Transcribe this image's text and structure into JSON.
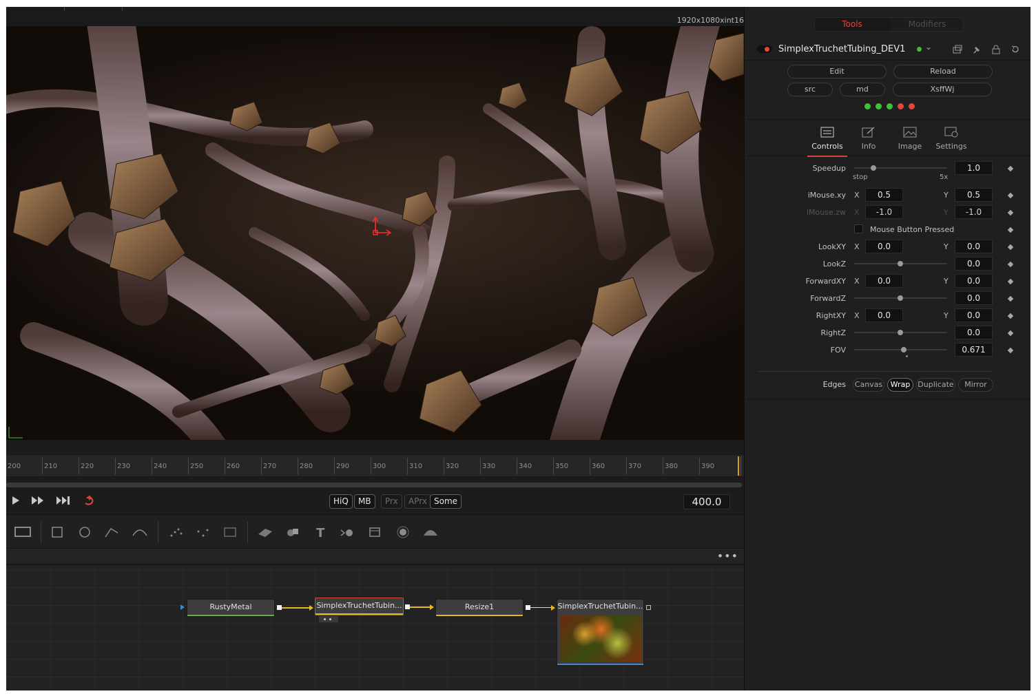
{
  "viewer": {
    "resolution": "1920x1080xint16"
  },
  "timeline": {
    "ruler_labels": [
      "200",
      "210",
      "220",
      "230",
      "240",
      "250",
      "260",
      "270",
      "280",
      "290",
      "300",
      "310",
      "320",
      "330",
      "340",
      "350",
      "360",
      "370",
      "380",
      "390"
    ],
    "current_time": "400.0"
  },
  "transport": {
    "toggles": [
      {
        "label": "HiQ",
        "active": true
      },
      {
        "label": "MB",
        "active": true
      },
      {
        "label": "Prx",
        "active": false
      },
      {
        "label": "APrx",
        "active": false
      },
      {
        "label": "Some",
        "active": true
      }
    ]
  },
  "flow": {
    "more_label": "•••",
    "nodes": {
      "rusty": "RustyMetal",
      "simplex": "SimplexTruchetTubin...",
      "resize": "Resize1",
      "output": "SimplexTruchetTubin..."
    }
  },
  "inspector": {
    "tabs_top": {
      "tools": "Tools",
      "modifiers": "Modifiers"
    },
    "tool_name": "SimplexTruchetTubing_DEV1",
    "buttons": {
      "edit": "Edit",
      "reload": "Reload",
      "src": "src",
      "md": "md",
      "xsffwj": "XsffWj"
    },
    "status_dots": [
      "#3ec23a",
      "#3ec23a",
      "#3ec23a",
      "#e2483a",
      "#e2483a"
    ],
    "tabs": [
      {
        "label": "Controls",
        "icon": "sliders-icon"
      },
      {
        "label": "Info",
        "icon": "pen-icon"
      },
      {
        "label": "Image",
        "icon": "image-icon"
      },
      {
        "label": "Settings",
        "icon": "gear-icon"
      }
    ],
    "controls": {
      "speedup": {
        "label": "Speedup",
        "value": "1.0",
        "min_label": "stop",
        "max_label": "5x"
      },
      "imouse_xy": {
        "label": "iMouse.xy",
        "x_label": "X",
        "y_label": "Y",
        "x": "0.5",
        "y": "0.5"
      },
      "imouse_zw": {
        "label": "iMouse.zw",
        "x_label": "X",
        "y_label": "Y",
        "x": "-1.0",
        "y": "-1.0"
      },
      "mouse_pressed": {
        "label": "Mouse Button Pressed",
        "checked": false
      },
      "lookxy": {
        "label": "LookXY",
        "x_label": "X",
        "y_label": "Y",
        "x": "0.0",
        "y": "0.0"
      },
      "lookz": {
        "label": "LookZ",
        "value": "0.0"
      },
      "forwardxy": {
        "label": "ForwardXY",
        "x_label": "X",
        "y_label": "Y",
        "x": "0.0",
        "y": "0.0"
      },
      "forwardz": {
        "label": "ForwardZ",
        "value": "0.0"
      },
      "rightxy": {
        "label": "RightXY",
        "x_label": "X",
        "y_label": "Y",
        "x": "0.0",
        "y": "0.0"
      },
      "rightz": {
        "label": "RightZ",
        "value": "0.0"
      },
      "fov": {
        "label": "FOV",
        "value": "0.671"
      }
    },
    "edges": {
      "label": "Edges",
      "options": [
        "Canvas",
        "Wrap",
        "Duplicate",
        "Mirror"
      ],
      "selected": "Wrap"
    }
  },
  "colors": {
    "accent_red": "#e0483a",
    "wire_yellow": "#e8b820",
    "playhead": "#d8a020"
  }
}
